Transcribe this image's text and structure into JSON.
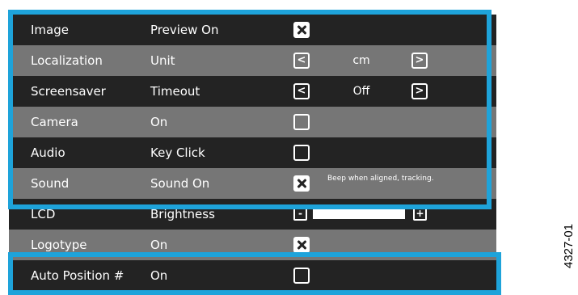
{
  "rows": [
    {
      "name": "Image",
      "setting": "Preview On",
      "control": "checkbox",
      "checked": true
    },
    {
      "name": "Localization",
      "setting": "Unit",
      "control": "stepper",
      "prev": "<",
      "value": "cm",
      "next": ">"
    },
    {
      "name": "Screensaver",
      "setting": "Timeout",
      "control": "stepper",
      "prev": "<",
      "value": "Off",
      "next": ">"
    },
    {
      "name": "Camera",
      "setting": "On",
      "control": "checkbox",
      "checked": false
    },
    {
      "name": "Audio",
      "setting": "Key Click",
      "control": "checkbox",
      "checked": false
    },
    {
      "name": "Sound",
      "setting": "Sound On",
      "control": "checkbox",
      "checked": true,
      "note": "Beep when aligned, tracking."
    },
    {
      "name": "LCD",
      "setting": "Brightness",
      "control": "slider",
      "minus": "-",
      "plus": "+",
      "level": 1.0
    },
    {
      "name": "Logotype",
      "setting": "On",
      "control": "checkbox",
      "checked": true
    },
    {
      "name": "Auto Position #",
      "setting": "On",
      "control": "checkbox",
      "checked": false
    }
  ],
  "figure_id": "4327-01",
  "colors": {
    "dark_row": "#232323",
    "light_row": "#767676",
    "highlight": "#1ea3da"
  }
}
